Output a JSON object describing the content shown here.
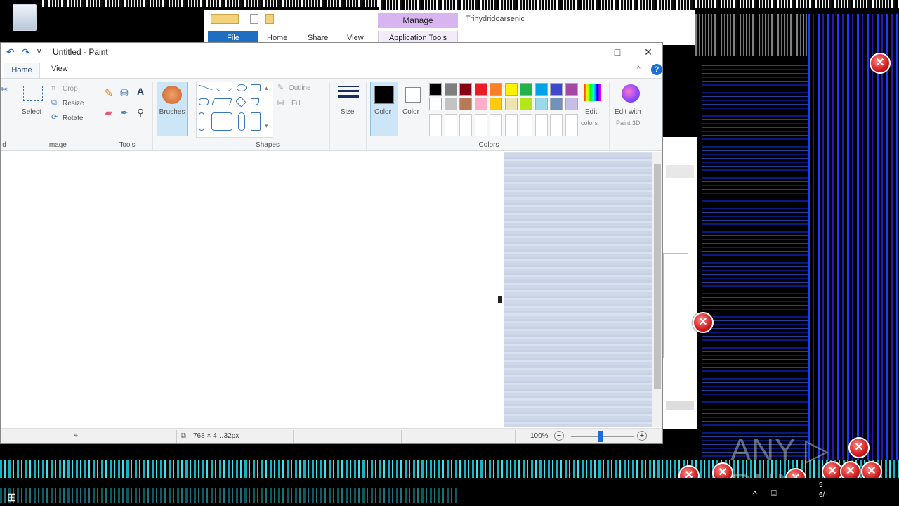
{
  "explorer": {
    "title": "Trihydridoarsenic",
    "manage_label": "Manage",
    "app_tools_label": "Application Tools",
    "tabs": [
      "File",
      "Home",
      "Share",
      "View"
    ]
  },
  "paint": {
    "title": "Untitled - Paint",
    "qat_more": "v",
    "ribbon_tabs": [
      "Home",
      "View"
    ],
    "groups": {
      "image": {
        "label": "Image",
        "select": "Select",
        "crop": "Crop",
        "resize": "Resize",
        "rotate": "Rotate"
      },
      "tools": {
        "label": "Tools"
      },
      "brushes": {
        "label": "Brushes"
      },
      "shapes": {
        "label": "Shapes",
        "outline": "Outline",
        "fill": "Fill"
      },
      "size": {
        "label": "Size"
      },
      "colors": {
        "label": "Colors",
        "color1": "Color",
        "color2": "Color",
        "edit": "Edit",
        "edit2": "colors",
        "row1": [
          "#000000",
          "#7f7f7f",
          "#880015",
          "#ed1c24",
          "#ff7f27",
          "#fff200",
          "#22b14c",
          "#00a2e8",
          "#3f48cc",
          "#a349a4"
        ],
        "row2": [
          "#ffffff",
          "#c3c3c3",
          "#b97a57",
          "#ffaec9",
          "#ffc90e",
          "#efe4b0",
          "#b5e61d",
          "#99d9ea",
          "#7092be",
          "#c8bfe7"
        ]
      },
      "paint3d": {
        "label": "Edit with",
        "label2": "Paint 3D"
      }
    },
    "left_partial": "d",
    "status": {
      "dimensions": "768 × 4…32px",
      "zoom": "100%",
      "zoom_minus": "−",
      "zoom_plus": "+"
    }
  },
  "watermark": "ANY ▷ RUN",
  "clock": {
    "line1": "5",
    "line2": "6/"
  }
}
